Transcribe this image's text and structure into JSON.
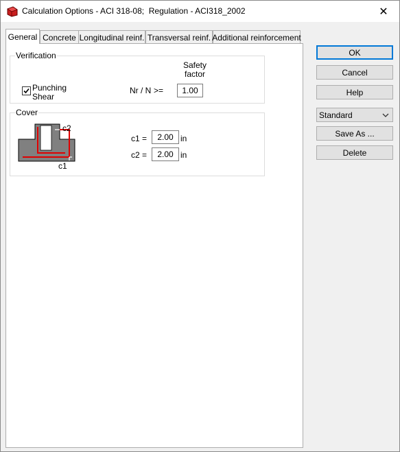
{
  "window": {
    "title": "Calculation Options - ACI 318-08;  Regulation - ACI318_2002",
    "close_glyph": "✕"
  },
  "tabs": [
    {
      "label": "General",
      "active": true
    },
    {
      "label": "Concrete",
      "active": false
    },
    {
      "label": "Longitudinal reinf.",
      "active": false
    },
    {
      "label": "Transversal reinf.",
      "active": false
    },
    {
      "label": "Additional reinforcement",
      "active": false
    }
  ],
  "verification": {
    "title": "Verification",
    "safety_header_line1": "Safety",
    "safety_header_line2": "factor",
    "punching_checked": true,
    "punching_label_line1": "Punching",
    "punching_label_line2": "Shear",
    "ratio_label": "Nr / N",
    "operator": ">=",
    "safety_value": "1.00"
  },
  "cover": {
    "title": "Cover",
    "diagram_c2": "c2",
    "diagram_c1": "c1",
    "c1_label": "c1 =",
    "c1_value": "2.00",
    "c1_unit": "in",
    "c2_label": "c2 =",
    "c2_value": "2.00",
    "c2_unit": "in"
  },
  "buttons": {
    "ok": "OK",
    "cancel": "Cancel",
    "help": "Help",
    "save_as": "Save As ...",
    "delete": "Delete"
  },
  "preset": {
    "selected": "Standard"
  },
  "colors": {
    "accent_border": "#0078d7",
    "diagram_fill": "#808080",
    "rebar": "#e00000"
  }
}
